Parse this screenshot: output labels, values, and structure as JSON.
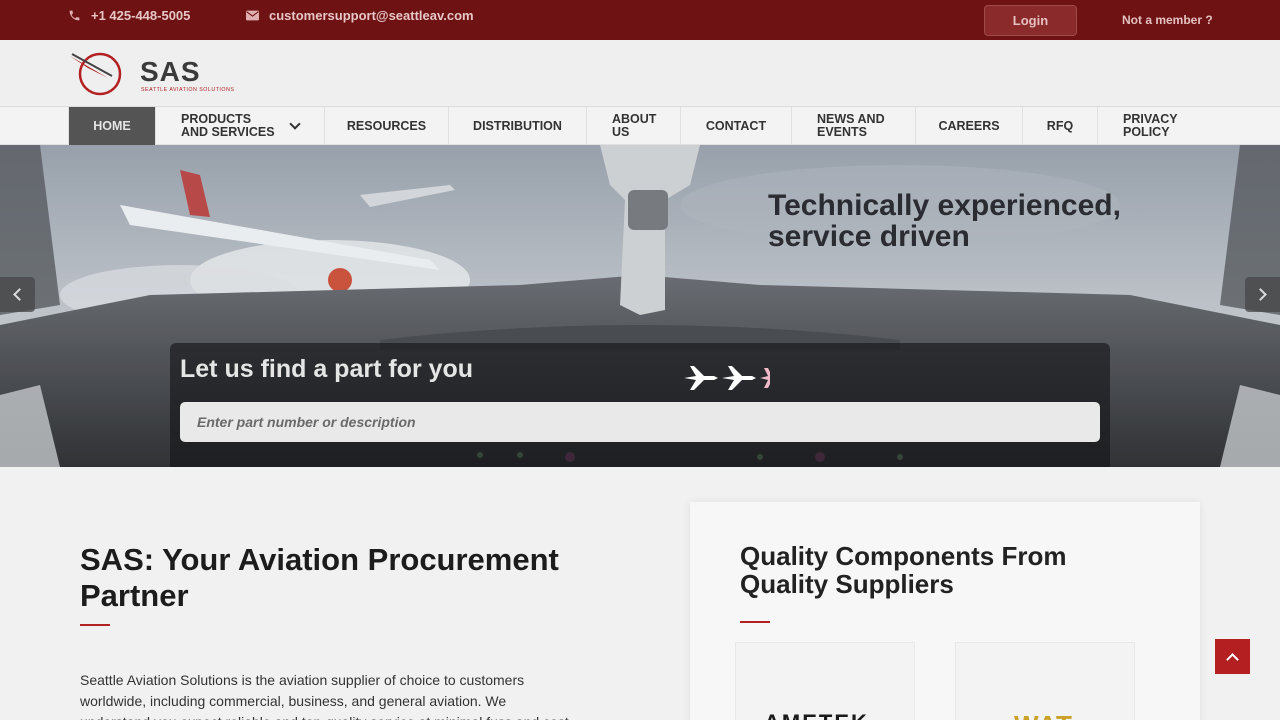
{
  "topbar": {
    "phone": "+1 425-448-5005",
    "email": "customersupport@seattleav.com",
    "login_label": "Login",
    "member_label": "Not a member ?"
  },
  "logo": {
    "name": "SAS",
    "subtitle": "SEATTLE AVIATION SOLUTIONS"
  },
  "nav": {
    "items": [
      {
        "label": "HOME",
        "active": true
      },
      {
        "label": "PRODUCTS AND SERVICES",
        "dropdown": true
      },
      {
        "label": "RESOURCES"
      },
      {
        "label": "DISTRIBUTION"
      },
      {
        "label": "ABOUT US"
      },
      {
        "label": "CONTACT"
      },
      {
        "label": "NEWS AND EVENTS"
      },
      {
        "label": "CAREERS"
      },
      {
        "label": "RFQ"
      },
      {
        "label": "PRIVACY POLICY"
      }
    ]
  },
  "hero": {
    "tagline": "Technically experienced, service driven",
    "search_title": "Let us find a part for you",
    "search_placeholder": "Enter part number or description"
  },
  "intro": {
    "heading": "SAS: Your Aviation Procurement Partner",
    "paragraph": "Seattle Aviation Solutions is the aviation supplier of choice to customers worldwide, including commercial, business, and general aviation. We understand you expect reliable and top-quality service at minimal fuss and cost. Our"
  },
  "suppliers_card": {
    "heading": "Quality Components From Quality Suppliers",
    "logos": [
      "AMETEK",
      "WAT"
    ]
  },
  "colors": {
    "brand_red": "#b22022",
    "topbar": "#6e1213",
    "nav_active": "#545454"
  }
}
